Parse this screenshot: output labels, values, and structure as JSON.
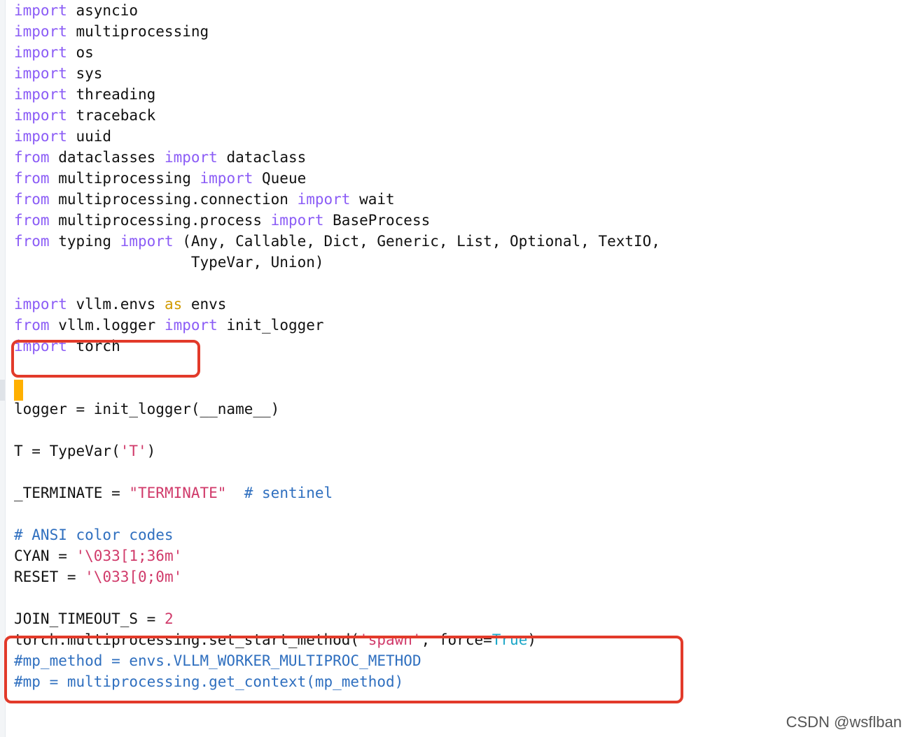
{
  "editor": {
    "lines": [
      [
        {
          "t": "import",
          "c": "kw"
        },
        {
          "t": " asyncio"
        }
      ],
      [
        {
          "t": "import",
          "c": "kw"
        },
        {
          "t": " multiprocessing"
        }
      ],
      [
        {
          "t": "import",
          "c": "kw"
        },
        {
          "t": " os"
        }
      ],
      [
        {
          "t": "import",
          "c": "kw"
        },
        {
          "t": " sys"
        }
      ],
      [
        {
          "t": "import",
          "c": "kw"
        },
        {
          "t": " threading"
        }
      ],
      [
        {
          "t": "import",
          "c": "kw"
        },
        {
          "t": " traceback"
        }
      ],
      [
        {
          "t": "import",
          "c": "kw"
        },
        {
          "t": " uuid"
        }
      ],
      [
        {
          "t": "from",
          "c": "kw"
        },
        {
          "t": " dataclasses "
        },
        {
          "t": "import",
          "c": "kw"
        },
        {
          "t": " dataclass"
        }
      ],
      [
        {
          "t": "from",
          "c": "kw"
        },
        {
          "t": " multiprocessing "
        },
        {
          "t": "import",
          "c": "kw"
        },
        {
          "t": " Queue"
        }
      ],
      [
        {
          "t": "from",
          "c": "kw"
        },
        {
          "t": " multiprocessing.connection "
        },
        {
          "t": "import",
          "c": "kw"
        },
        {
          "t": " wait"
        }
      ],
      [
        {
          "t": "from",
          "c": "kw"
        },
        {
          "t": " multiprocessing.process "
        },
        {
          "t": "import",
          "c": "kw"
        },
        {
          "t": " BaseProcess"
        }
      ],
      [
        {
          "t": "from",
          "c": "kw"
        },
        {
          "t": " typing "
        },
        {
          "t": "import",
          "c": "kw"
        },
        {
          "t": " (Any, Callable, Dict, Generic, List, Optional, TextIO,"
        }
      ],
      [
        {
          "t": "                    TypeVar, Union)"
        }
      ],
      [],
      [
        {
          "t": "import",
          "c": "kw"
        },
        {
          "t": " vllm.envs "
        },
        {
          "t": "as",
          "c": "kw2"
        },
        {
          "t": " envs"
        }
      ],
      [
        {
          "t": "from",
          "c": "kw"
        },
        {
          "t": " vllm.logger "
        },
        {
          "t": "import",
          "c": "kw"
        },
        {
          "t": " init_logger"
        }
      ],
      [
        {
          "t": "import",
          "c": "kw"
        },
        {
          "t": " torch"
        }
      ],
      [],
      [],
      [
        {
          "t": "logger = init_logger(__name__)"
        }
      ],
      [],
      [
        {
          "t": "T = TypeVar("
        },
        {
          "t": "'T'",
          "c": "str"
        },
        {
          "t": ")"
        }
      ],
      [],
      [
        {
          "t": "_TERMINATE = "
        },
        {
          "t": "\"TERMINATE\"",
          "c": "str"
        },
        {
          "t": "  "
        },
        {
          "t": "# sentinel",
          "c": "cmt"
        }
      ],
      [],
      [
        {
          "t": "# ANSI color codes",
          "c": "cmt"
        }
      ],
      [
        {
          "t": "CYAN = "
        },
        {
          "t": "'\\033[1;36m'",
          "c": "str"
        }
      ],
      [
        {
          "t": "RESET = "
        },
        {
          "t": "'\\033[0;0m'",
          "c": "str"
        }
      ],
      [],
      [
        {
          "t": "JOIN_TIMEOUT_S = "
        },
        {
          "t": "2",
          "c": "num"
        }
      ],
      [
        {
          "t": "torch.multiprocessing.set_start_method("
        },
        {
          "t": "'spawn'",
          "c": "str"
        },
        {
          "t": ", force="
        },
        {
          "t": "True",
          "c": "bool"
        },
        {
          "t": ")"
        }
      ],
      [
        {
          "t": "#mp_method = envs.VLLM_WORKER_MULTIPROC_METHOD",
          "c": "cmt"
        }
      ],
      [
        {
          "t": "#mp = multiprocessing.get_context(mp_method)",
          "c": "cmt"
        }
      ]
    ]
  },
  "watermark": "CSDN @wsflban"
}
